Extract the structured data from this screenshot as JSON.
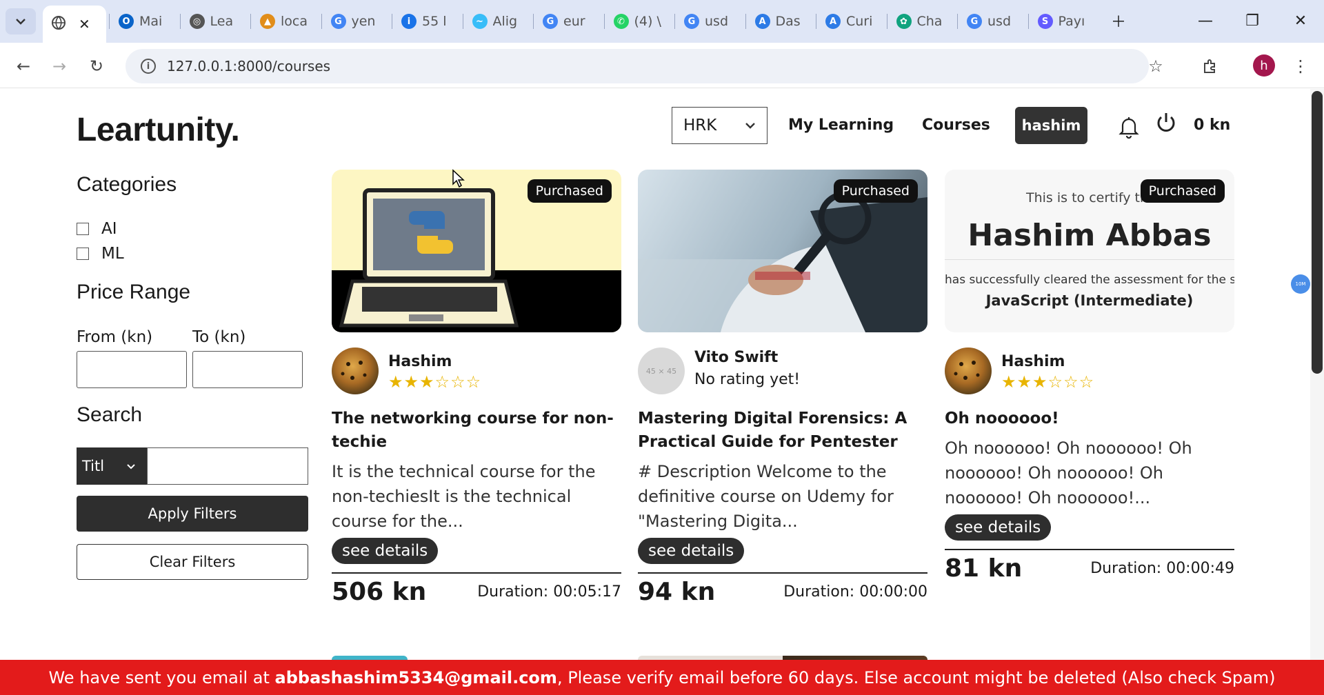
{
  "browser": {
    "tabs": [
      {
        "label": "",
        "icon": "globe-icon",
        "active": true
      },
      {
        "label": "Mai",
        "icon": "outlook-icon"
      },
      {
        "label": "Lea",
        "icon": "globe-icon"
      },
      {
        "label": "loca",
        "icon": "pma-icon"
      },
      {
        "label": "yen",
        "icon": "google-icon"
      },
      {
        "label": "55 l",
        "icon": "tool-icon"
      },
      {
        "label": "Alig",
        "icon": "tailwind-icon"
      },
      {
        "label": "eur",
        "icon": "google-icon"
      },
      {
        "label": "(4) \\",
        "icon": "whatsapp-icon"
      },
      {
        "label": "usd",
        "icon": "google-icon"
      },
      {
        "label": "Das",
        "icon": "api-icon"
      },
      {
        "label": "Curi",
        "icon": "api-icon"
      },
      {
        "label": "Cha",
        "icon": "chatgpt-icon"
      },
      {
        "label": "usd",
        "icon": "google-icon"
      },
      {
        "label": "Payı",
        "icon": "stripe-icon"
      }
    ],
    "url": "127.0.0.1:8000/courses",
    "profile_initial": "h"
  },
  "header": {
    "logo": "Leartunity.",
    "currency": "HRK",
    "nav": [
      "My Learning",
      "Courses"
    ],
    "user": "hashim",
    "balance": "0 kn"
  },
  "sidebar": {
    "categories_title": "Categories",
    "categories": [
      "AI",
      "ML"
    ],
    "price_title": "Price Range",
    "from_label": "From (kn)",
    "to_label": "To (kn)",
    "search_title": "Search",
    "search_field": "Titl",
    "apply": "Apply Filters",
    "clear": "Clear Filters"
  },
  "courses": [
    {
      "badge": "Purchased",
      "author": "Hashim",
      "rating_text": "",
      "stars": 3,
      "title": "The networking course for non-techie",
      "description": "It is the technical course for the non-techiesIt is the technical course for the...",
      "button": "see details",
      "price": "506 kn",
      "duration": "Duration: 00:05:17"
    },
    {
      "badge": "Purchased",
      "author": "Vito Swift",
      "rating_text": "No rating yet!",
      "avatar_text": "45 × 45",
      "stars": 0,
      "title": "Mastering Digital Forensics: A Practical Guide for Pentester",
      "description": "# Description Welcome to the definitive course on Udemy for \"Mastering Digita...",
      "button": "see details",
      "price": "94 kn",
      "duration": "Duration: 00:00:00"
    },
    {
      "badge": "Purchased",
      "author": "Hashim",
      "rating_text": "",
      "stars": 3,
      "title": "Oh noooooo!",
      "description": "Oh noooooo! Oh noooooo! Oh noooooo! Oh noooooo! Oh noooooo! Oh noooooo!...",
      "button": "see details",
      "price": "81 kn",
      "duration": "Duration: 00:00:49",
      "cert": {
        "line1": "This is to certify th",
        "name": "Hashim Abbas",
        "line2": "has successfully cleared the assessment for the skill",
        "skill": "JavaScript (Intermediate)"
      }
    }
  ],
  "banner": {
    "before": "We have sent you email at ",
    "email": "abbashashim5334@gmail.com",
    "after": ", Please verify email before 60 days. Else account might be deleted (Also check Spam)"
  },
  "floating_badge": "10M",
  "colors": {
    "banner": "#e31b1b",
    "dark": "#2e2e2e",
    "star": "#e8b400"
  }
}
